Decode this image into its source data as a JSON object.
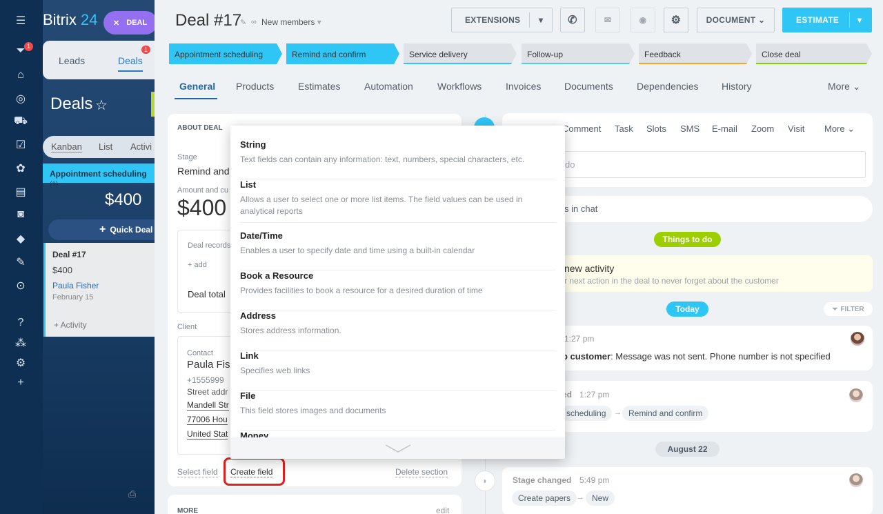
{
  "app": {
    "brand_name": "Bitrix",
    "brand_num": "24",
    "deal_pill": "DEAL",
    "rail_badge": "1"
  },
  "left_tabs": {
    "leads": "Leads",
    "deals": "Deals",
    "deals_badge": "1"
  },
  "deals_heading": "Deals",
  "view_tabs": [
    "Kanban",
    "List",
    "Activi"
  ],
  "kanban": {
    "stage": "Appointment scheduling",
    "stage_count": "(1)",
    "stage_amount": "$400",
    "quick_deal": "Quick Deal",
    "card": {
      "title": "Deal #17",
      "amount": "$400",
      "contact": "Paula Fisher",
      "date": "February 15",
      "activity": "+ Activity"
    }
  },
  "header": {
    "title": "Deal #17",
    "subtitle": "New members",
    "extensions": "EXTENSIONS",
    "document": "DOCUMENT",
    "estimate": "ESTIMATE"
  },
  "stages": [
    {
      "label": "Appointment scheduling",
      "color": "#2fc6f6",
      "underline": "#2fc6f6"
    },
    {
      "label": "Remind and confirm",
      "color": "#2fc6f6",
      "underline": "#2fc6f6"
    },
    {
      "label": "Service delivery",
      "color": "#dfe3e8",
      "underline": "#2fc6f6"
    },
    {
      "label": "Follow-up",
      "color": "#dfe3e8",
      "underline": "#55d0e0"
    },
    {
      "label": "Feedback",
      "color": "#dfe3e8",
      "underline": "#f5a623"
    },
    {
      "label": "Close deal",
      "color": "#dfe3e8",
      "underline": "#7bd500"
    }
  ],
  "tabs": [
    "General",
    "Products",
    "Estimates",
    "Automation",
    "Workflows",
    "Invoices",
    "Documents",
    "Dependencies",
    "History",
    "More"
  ],
  "about": {
    "heading": "ABOUT DEAL",
    "stage_label": "Stage",
    "stage_value": "Remind and",
    "amount_label": "Amount and cu",
    "amount_value": "$400",
    "records_label": "Deal records",
    "add": "+ add",
    "deal_total": "Deal total",
    "client_label": "Client",
    "contact_label": "Contact",
    "contact_name": "Paula Fish",
    "phone": "+1555999",
    "street_label": "Street addr",
    "addr1": "Mandell Str",
    "addr2": "77006 Hou",
    "addr3": "United Stat",
    "select_field": "Select field",
    "create_field": "Create field",
    "delete_section": "Delete section",
    "more_heading": "MORE",
    "edit": "edit"
  },
  "activity": {
    "tabs": [
      "Comment",
      "Task",
      "Slots",
      "SMS",
      "E-mail",
      "Zoom",
      "Visit",
      "More"
    ],
    "input_placeholder": "do",
    "chat": "s in chat",
    "things_pill": "Things to do",
    "new_activity": "new activity",
    "new_activity_desc": "r next action in the deal to never forget about the customer",
    "today_pill": "Today",
    "filter": "FILTER",
    "item1_time": "1:27 pm",
    "item1_bold": "o customer",
    "item1_text": ": Message was not sent. Phone number is not specified",
    "item2_title": "ed",
    "item2_time": "1:27 pm",
    "item2_from": "scheduling",
    "item2_to": "Remind and confirm",
    "date_pill": "August 22",
    "item3_title": "Stage changed",
    "item3_time": "5:49 pm",
    "item3_from": "Create papers",
    "item3_to": "New"
  },
  "dropdown": [
    {
      "title": "String",
      "desc": "Text fields can contain any information: text, numbers, special characters, etc."
    },
    {
      "title": "List",
      "desc": "Allows a user to select one or more list items. The field values can be used in analytical reports"
    },
    {
      "title": "Date/Time",
      "desc": "Enables a user to specify date and time using a built-in calendar"
    },
    {
      "title": "Book a Resource",
      "desc": "Provides facilities to book a resource for a desired duration of time"
    },
    {
      "title": "Address",
      "desc": "Stores address information."
    },
    {
      "title": "Link",
      "desc": "Specifies web links"
    },
    {
      "title": "File",
      "desc": "This field stores images and documents"
    },
    {
      "title": "Money",
      "desc": ""
    }
  ]
}
